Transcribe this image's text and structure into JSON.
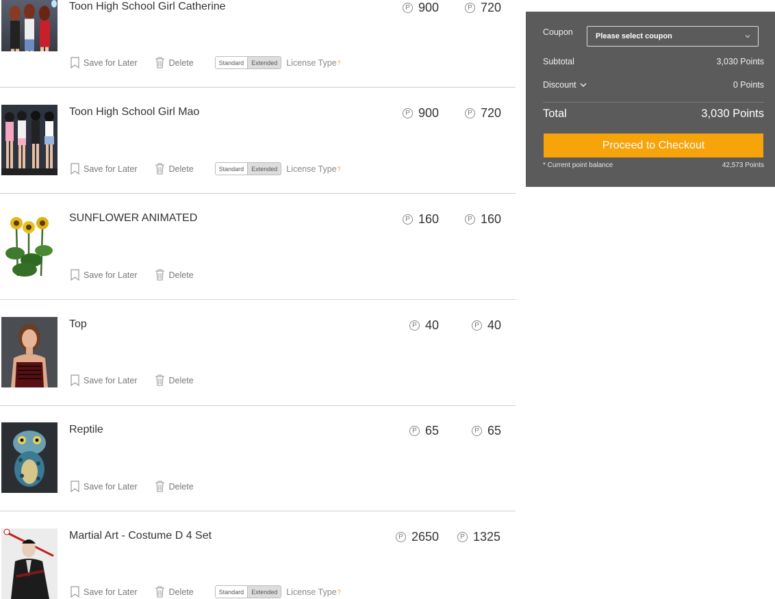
{
  "cart": {
    "items": [
      {
        "name": "Toon High School Girl Catherine",
        "price": "900",
        "sale_price": "720",
        "save_label": "Save for Later",
        "delete_label": "Delete",
        "has_license": true,
        "license": {
          "standard": "Standard",
          "extended": "Extended",
          "label": "License Type",
          "help": "?"
        }
      },
      {
        "name": "Toon High School Girl Mao",
        "price": "900",
        "sale_price": "720",
        "save_label": "Save for Later",
        "delete_label": "Delete",
        "has_license": true,
        "license": {
          "standard": "Standard",
          "extended": "Extended",
          "label": "License Type",
          "help": "?"
        }
      },
      {
        "name": "SUNFLOWER ANIMATED",
        "price": "160",
        "sale_price": "160",
        "save_label": "Save for Later",
        "delete_label": "Delete",
        "has_license": false
      },
      {
        "name": "Top",
        "price": "40",
        "sale_price": "40",
        "save_label": "Save for Later",
        "delete_label": "Delete",
        "has_license": false
      },
      {
        "name": "Reptile",
        "price": "65",
        "sale_price": "65",
        "save_label": "Save for Later",
        "delete_label": "Delete",
        "has_license": false
      },
      {
        "name": "Martial Art - Costume D 4 Set",
        "price": "2650",
        "sale_price": "1325",
        "save_label": "Save for Later",
        "delete_label": "Delete",
        "has_license": true,
        "license": {
          "standard": "Standard",
          "extended": "Extended",
          "label": "License Type",
          "help": "?"
        }
      }
    ],
    "point_icon": "P"
  },
  "summary": {
    "coupon_label": "Coupon",
    "coupon_placeholder": "Please select coupon",
    "subtotal_label": "Subtotal",
    "subtotal_value": "3,030 Points",
    "discount_label": "Discount",
    "discount_value": "0 Points",
    "total_label": "Total",
    "total_value": "3,030 Points",
    "checkout_label": "Proceed to Checkout",
    "balance_label": "* Current point balance",
    "balance_value": "42,573 Points"
  },
  "colors": {
    "accent": "#f7a30a",
    "panel": "#5b5b5b"
  }
}
